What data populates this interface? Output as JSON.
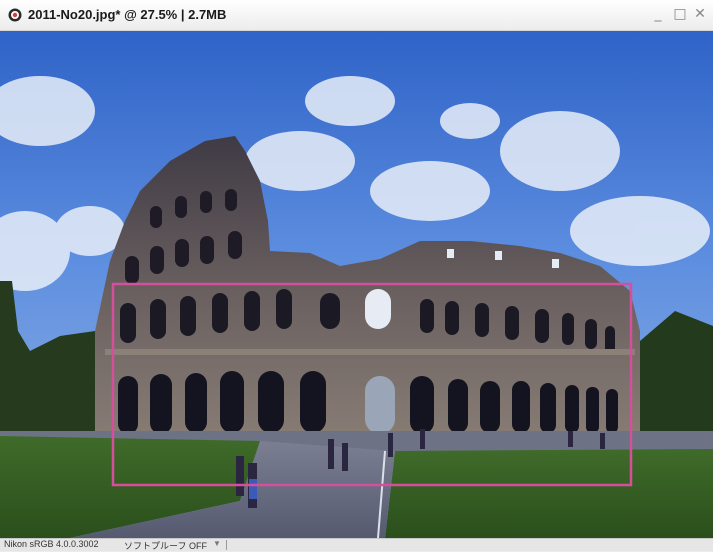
{
  "window": {
    "title": "2011-No20.jpg* @ 27.5% | 2.7MB",
    "app_icon": "viewnx-app-icon",
    "controls": {
      "minimize": "_",
      "maximize": "□",
      "close": "✕"
    }
  },
  "image": {
    "description_icon": "photo-canvas",
    "selection_color": "#d64f9b"
  },
  "statusbar": {
    "color_profile": "Nikon sRGB 4.0.0.3002",
    "softproof_label": "ソフトプルーフ OFF",
    "softproof_arrow": "▼"
  }
}
